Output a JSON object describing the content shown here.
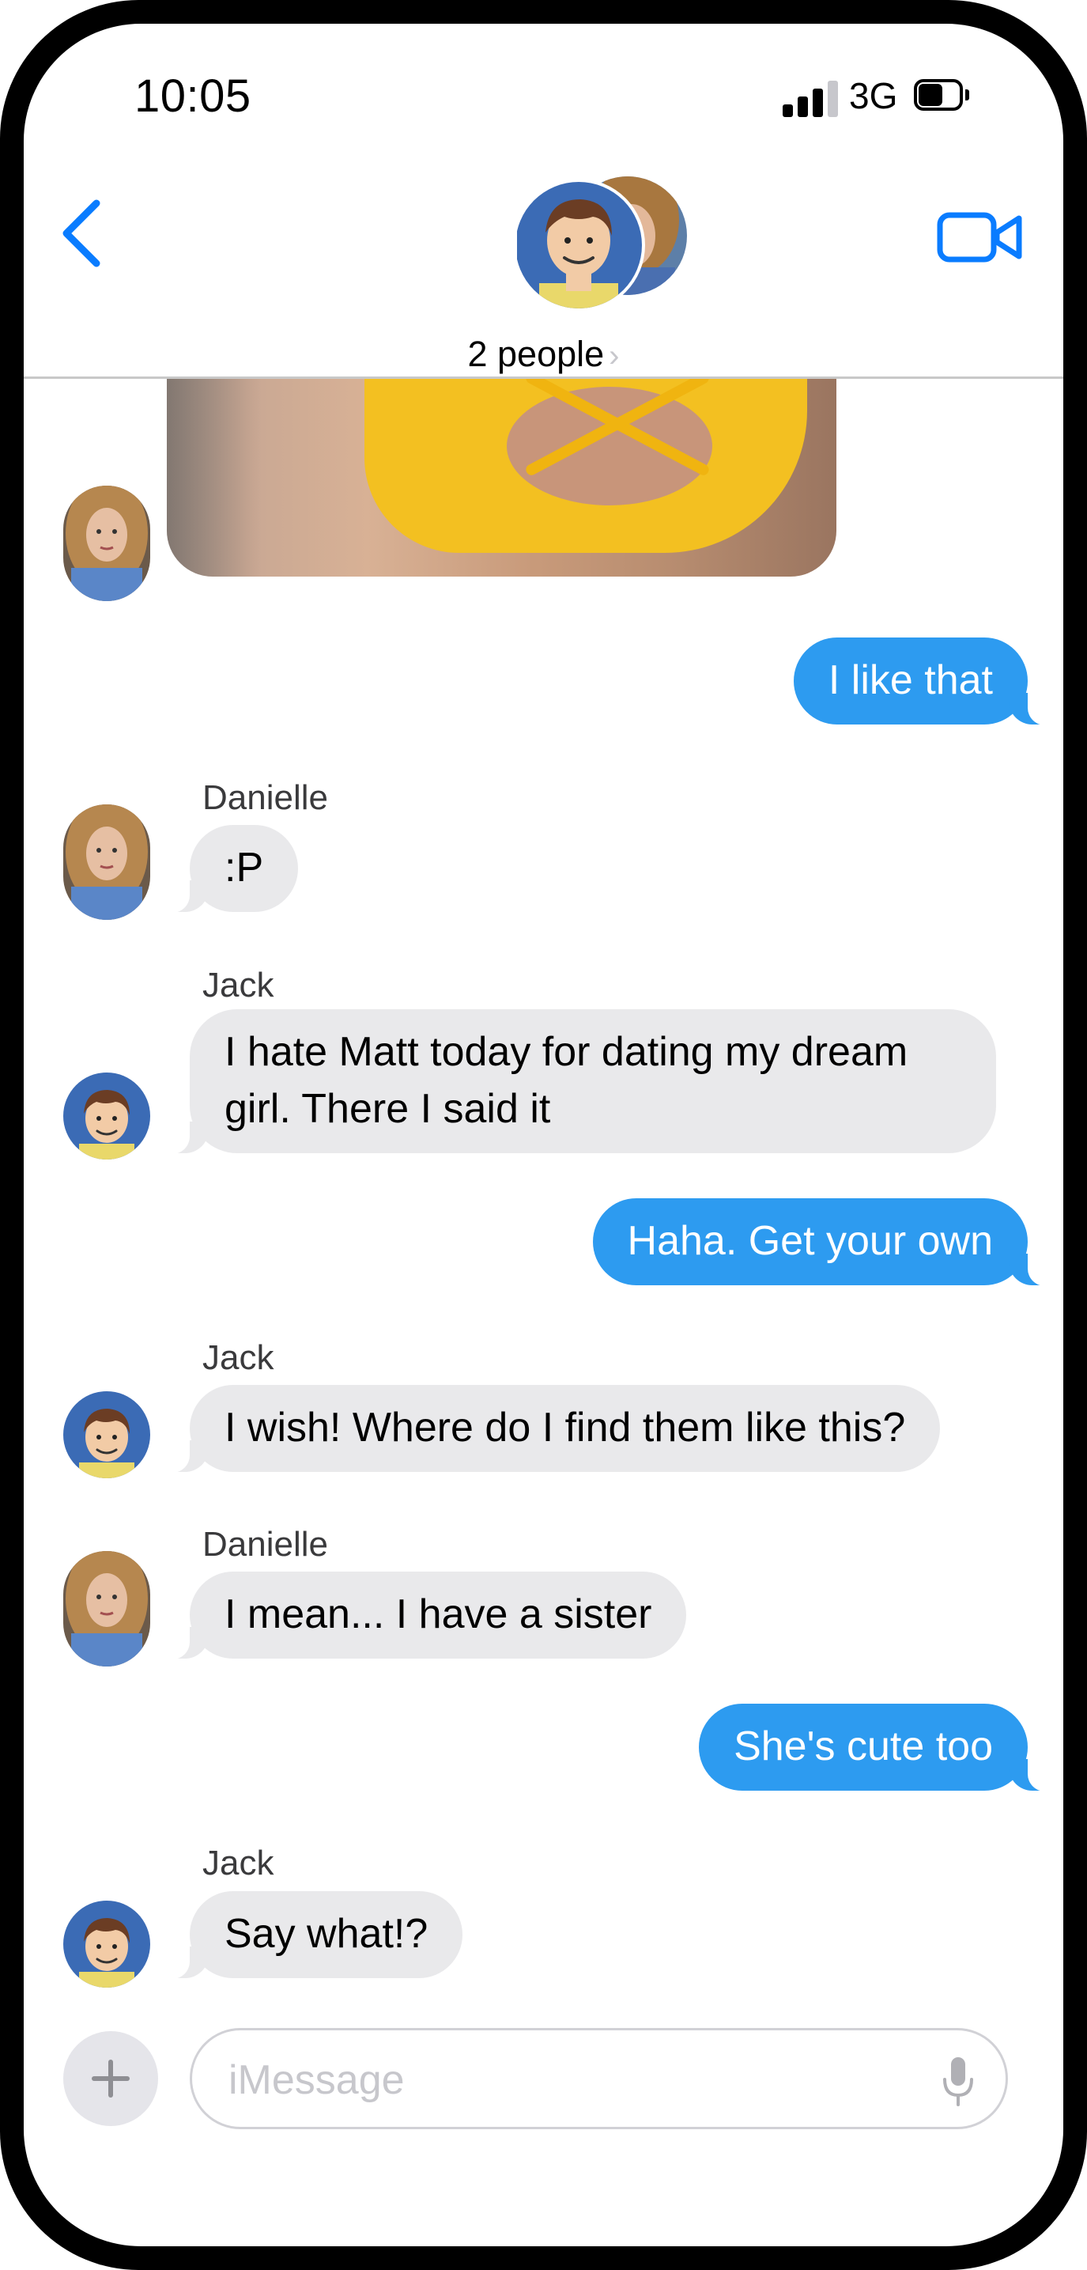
{
  "status_bar": {
    "time": "10:05",
    "network": "3G"
  },
  "header": {
    "title": "2 people",
    "chevron": "›"
  },
  "thread": {
    "messages": [
      {
        "id": "m1",
        "kind": "photo",
        "from": "Danielle"
      },
      {
        "id": "m2",
        "kind": "text",
        "direction": "outgoing",
        "text": "I like that"
      },
      {
        "id": "m3",
        "kind": "text",
        "direction": "incoming",
        "sender": "Danielle",
        "text": ":P"
      },
      {
        "id": "m4",
        "kind": "text",
        "direction": "incoming",
        "sender": "Jack",
        "text": "I hate Matt today for dating my dream girl.  There I said it"
      },
      {
        "id": "m5",
        "kind": "text",
        "direction": "outgoing",
        "text": "Haha.  Get your own"
      },
      {
        "id": "m6",
        "kind": "text",
        "direction": "incoming",
        "sender": "Jack",
        "text": "I wish!  Where do I find them like this?"
      },
      {
        "id": "m7",
        "kind": "text",
        "direction": "incoming",
        "sender": "Danielle",
        "text": "I mean... I have a sister"
      },
      {
        "id": "m8",
        "kind": "text",
        "direction": "outgoing",
        "text": "She's cute too"
      },
      {
        "id": "m9",
        "kind": "text",
        "direction": "incoming",
        "sender": "Jack",
        "text": "Say what!?"
      }
    ]
  },
  "composer": {
    "placeholder": "iMessage"
  },
  "icons": {
    "back": "chevron-left-icon",
    "video": "video-camera-icon",
    "plus": "plus-icon",
    "mic": "microphone-icon"
  },
  "colors": {
    "accent": "#0a7cff",
    "outgoing_bubble": "#2d9bf0",
    "incoming_bubble": "#e9e9eb"
  }
}
